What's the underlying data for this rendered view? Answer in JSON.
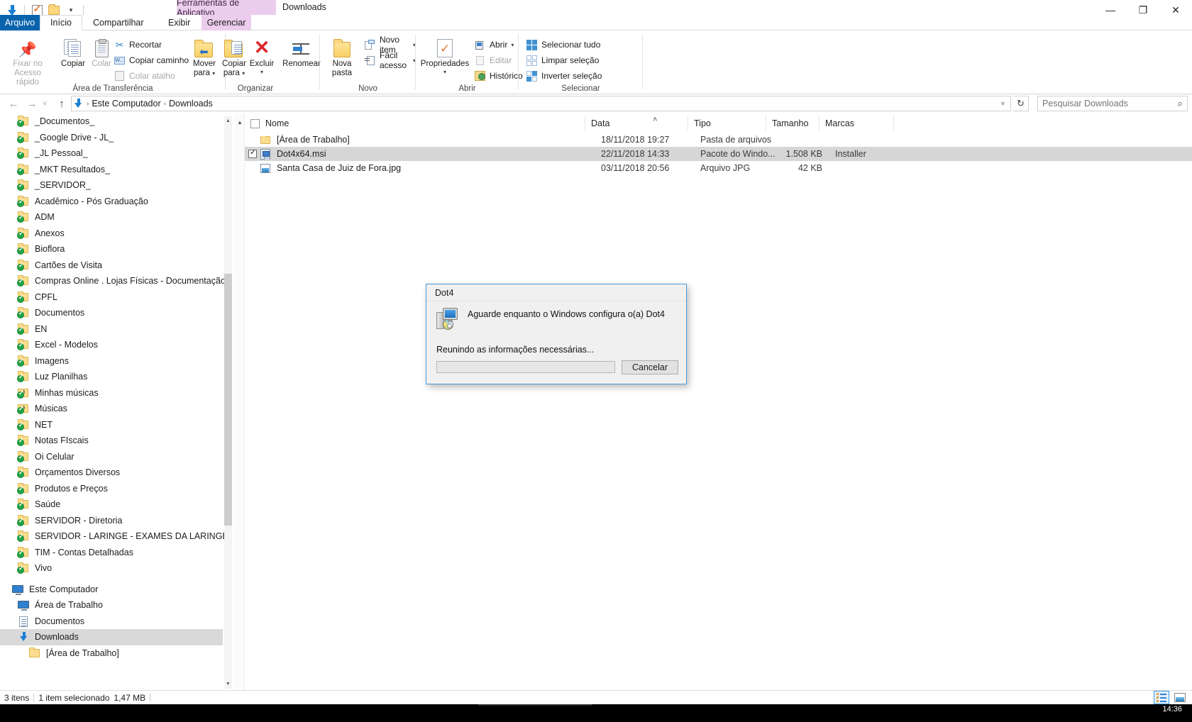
{
  "window": {
    "title": "Downloads",
    "contextual_tab_group": "Ferramentas de Aplicativo",
    "minimize": "—",
    "maximize": "❐",
    "close": "✕",
    "help_icon": "?",
    "ribbon_collapse_caret": "⌃"
  },
  "quick_access": {
    "download_icon": "download-icon",
    "checkbox_icon": "properties-checkbox-icon",
    "folder_icon": "new-folder-icon",
    "dropdown_caret": "▾"
  },
  "tabs": [
    {
      "label": "Arquivo",
      "state": "file"
    },
    {
      "label": "Início",
      "state": "active"
    },
    {
      "label": "Compartilhar",
      "state": "normal"
    },
    {
      "label": "Exibir",
      "state": "normal"
    },
    {
      "label": "Gerenciar",
      "state": "contextual"
    }
  ],
  "ribbon": {
    "groups": [
      {
        "title": "Área de Transferência",
        "big_buttons": [
          {
            "label_line1": "Fixar no",
            "label_line2": "Acesso rápido",
            "icon": "pin-icon",
            "disabled": true
          },
          {
            "label_line1": "Copiar",
            "label_line2": "",
            "icon": "copy-icon",
            "disabled": false
          },
          {
            "label_line1": "Colar",
            "label_line2": "",
            "icon": "paste-icon",
            "disabled": true
          }
        ],
        "small_buttons": [
          {
            "label": "Recortar",
            "icon": "scissors-icon",
            "disabled": false
          },
          {
            "label": "Copiar caminho",
            "icon": "copy-path-icon",
            "disabled": false
          },
          {
            "label": "Colar atalho",
            "icon": "paste-shortcut-icon",
            "disabled": true
          }
        ]
      },
      {
        "title": "Organizar",
        "big_buttons": [
          {
            "label_line1": "Mover",
            "label_line2": "para",
            "icon": "move-to-icon",
            "caret": "▾",
            "disabled": false
          },
          {
            "label_line1": "Copiar",
            "label_line2": "para",
            "icon": "copy-to-icon",
            "caret": "▾",
            "disabled": false
          },
          {
            "label_line1": "Excluir",
            "label_line2": "",
            "icon": "delete-x-icon",
            "caret": "▾",
            "disabled": false
          },
          {
            "label_line1": "Renomear",
            "label_line2": "",
            "icon": "rename-icon",
            "disabled": false
          }
        ],
        "small_buttons": []
      },
      {
        "title": "Novo",
        "big_buttons": [
          {
            "label_line1": "Nova",
            "label_line2": "pasta",
            "icon": "new-folder-icon",
            "disabled": false
          }
        ],
        "small_buttons": [
          {
            "label": "Novo item",
            "icon": "new-item-icon",
            "caret": "▾",
            "disabled": false
          },
          {
            "label": "Fácil acesso",
            "icon": "easy-access-icon",
            "caret": "▾",
            "disabled": false
          }
        ]
      },
      {
        "title": "Abrir",
        "big_buttons": [
          {
            "label_line1": "Propriedades",
            "label_line2": "",
            "icon": "properties-icon",
            "caret": "▾",
            "disabled": false
          }
        ],
        "small_buttons": [
          {
            "label": "Abrir",
            "icon": "open-icon",
            "caret": "▾",
            "disabled": false
          },
          {
            "label": "Editar",
            "icon": "edit-icon",
            "disabled": true
          },
          {
            "label": "Histórico",
            "icon": "history-icon",
            "disabled": false
          }
        ]
      },
      {
        "title": "Selecionar",
        "big_buttons": [],
        "small_buttons": [
          {
            "label": "Selecionar tudo",
            "icon": "select-all-icon",
            "disabled": false
          },
          {
            "label": "Limpar seleção",
            "icon": "clear-selection-icon",
            "disabled": false
          },
          {
            "label": "Inverter seleção",
            "icon": "invert-selection-icon",
            "disabled": false
          }
        ]
      }
    ]
  },
  "address": {
    "back_icon": "←",
    "forward_icon": "→",
    "recent_caret": "˅",
    "up_icon": "↑",
    "path_icon": "downloads-icon",
    "breadcrumbs": [
      "Este Computador",
      "Downloads"
    ],
    "separator": "›",
    "dropdown_caret": "˅",
    "refresh_icon": "↻"
  },
  "search": {
    "placeholder": "Pesquisar Downloads",
    "value": "",
    "icon": "search-icon"
  },
  "nav_pane": {
    "quick_items": [
      {
        "label": "_Documentos_",
        "icon": "synced-folder-icon"
      },
      {
        "label": "_Google Drive - JL_",
        "icon": "synced-folder-icon"
      },
      {
        "label": "_JL Pessoal_",
        "icon": "synced-folder-icon"
      },
      {
        "label": "_MKT Resultados_",
        "icon": "synced-folder-icon"
      },
      {
        "label": "_SERVIDOR_",
        "icon": "synced-folder-icon"
      },
      {
        "label": "Acadêmico - Pós Graduação",
        "icon": "synced-folder-icon"
      },
      {
        "label": "ADM",
        "icon": "synced-folder-icon"
      },
      {
        "label": "Anexos",
        "icon": "synced-folder-icon"
      },
      {
        "label": "Bioflora",
        "icon": "synced-folder-icon"
      },
      {
        "label": "Cartões de Visita",
        "icon": "synced-folder-icon"
      },
      {
        "label": "Compras Online . Lojas Físicas - Documentação",
        "icon": "synced-folder-icon"
      },
      {
        "label": "CPFL",
        "icon": "synced-folder-icon"
      },
      {
        "label": "Documentos",
        "icon": "synced-folder-icon"
      },
      {
        "label": "EN",
        "icon": "synced-folder-icon"
      },
      {
        "label": "Excel - Modelos",
        "icon": "synced-folder-icon"
      },
      {
        "label": "Imagens",
        "icon": "synced-folder-icon"
      },
      {
        "label": "Luz Planilhas",
        "icon": "synced-folder-icon"
      },
      {
        "label": "Minhas músicas",
        "icon": "synced-music-folder-icon"
      },
      {
        "label": "Músicas",
        "icon": "synced-music-folder-icon"
      },
      {
        "label": "NET",
        "icon": "synced-folder-icon"
      },
      {
        "label": "Notas FIscais",
        "icon": "synced-folder-icon"
      },
      {
        "label": "Oi Celular",
        "icon": "synced-folder-icon"
      },
      {
        "label": "Orçamentos Diversos",
        "icon": "synced-folder-icon"
      },
      {
        "label": "Produtos e Preços",
        "icon": "synced-folder-icon"
      },
      {
        "label": "Saúde",
        "icon": "synced-folder-icon"
      },
      {
        "label": "SERVIDOR - Diretoria",
        "icon": "synced-folder-icon"
      },
      {
        "label": "SERVIDOR - LARINGE - EXAMES DA LARINGE",
        "icon": "synced-folder-icon"
      },
      {
        "label": "TIM - Contas Detalhadas",
        "icon": "synced-folder-icon"
      },
      {
        "label": "Vivo",
        "icon": "synced-folder-icon"
      }
    ],
    "computer_items": [
      {
        "label": "Este Computador",
        "icon": "this-pc-icon",
        "level": 1,
        "selected": false
      },
      {
        "label": "Área de Trabalho",
        "icon": "desktop-icon",
        "level": 2,
        "selected": false
      },
      {
        "label": "Documentos",
        "icon": "documents-icon",
        "level": 2,
        "selected": false
      },
      {
        "label": "Downloads",
        "icon": "downloads-icon",
        "level": 2,
        "selected": true
      },
      {
        "label": "[Área de Trabalho]",
        "icon": "folder-icon",
        "level": 3,
        "selected": false
      }
    ]
  },
  "file_list": {
    "columns": [
      {
        "label": "Nome",
        "sorted": true
      },
      {
        "label": "Data",
        "sorted": false
      },
      {
        "label": "Tipo",
        "sorted": false
      },
      {
        "label": "Tamanho",
        "sorted": false
      },
      {
        "label": "Marcas",
        "sorted": false
      }
    ],
    "sort_indicator": "˄",
    "rows": [
      {
        "name": "[Área de Trabalho]",
        "date": "18/11/2018 19:27",
        "type": "Pasta de arquivos",
        "size": "",
        "tags": "",
        "icon": "folder-icon",
        "checked": false,
        "selected": false
      },
      {
        "name": "Dot4x64.msi",
        "date": "22/11/2018 14:33",
        "type": "Pacote do Windo...",
        "size": "1.508 KB",
        "tags": "Installer",
        "icon": "msi-package-icon",
        "checked": true,
        "selected": true
      },
      {
        "name": "Santa Casa de Juiz de Fora.jpg",
        "date": "03/11/2018 20:56",
        "type": "Arquivo JPG",
        "size": "42 KB",
        "tags": "",
        "icon": "jpg-image-icon",
        "checked": false,
        "selected": false
      }
    ]
  },
  "dialog": {
    "title": "Dot4",
    "icon": "windows-installer-icon",
    "message": "Aguarde enquanto o Windows configura o(a) Dot4",
    "status": "Reunindo as informações necessárias...",
    "progress_percent": 0,
    "cancel_label": "Cancelar"
  },
  "status_bar": {
    "item_count": "3 itens",
    "selection": "1 item selecionado",
    "selection_size": "1,47 MB",
    "view_details_icon": "details-view-icon",
    "view_thumbnails_icon": "thumbnails-view-icon",
    "active_view": "details"
  },
  "taskbar": {
    "clock_time": "14:36"
  },
  "colors": {
    "accent": "#0a63ad",
    "contextual_tab": "#eccdee",
    "selection": "#d6d6d6",
    "sync_green": "#22a346",
    "dialog_border": "#4a9bdc"
  }
}
